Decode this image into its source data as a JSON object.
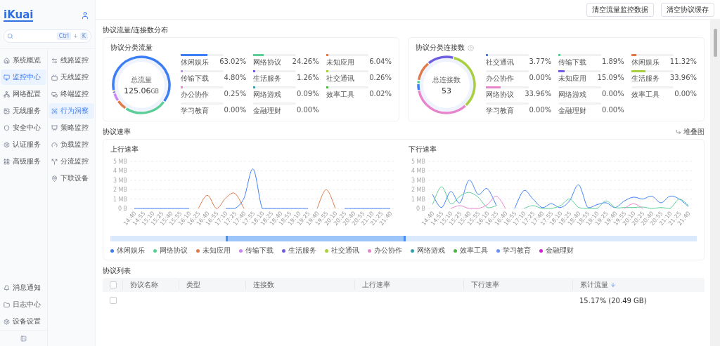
{
  "sidebar": {
    "logo": "iKuai",
    "search": {
      "keys": [
        "Ctrl",
        "K"
      ],
      "joiner": "+"
    },
    "nav": [
      {
        "label": "系统概览",
        "selected": false
      },
      {
        "label": "监控中心",
        "selected": true
      },
      {
        "label": "网络配置",
        "selected": false
      },
      {
        "label": "无线服务",
        "selected": false
      },
      {
        "label": "安全中心",
        "selected": false
      },
      {
        "label": "认证服务",
        "selected": false
      },
      {
        "label": "高级服务",
        "selected": false
      }
    ],
    "subnav": [
      {
        "label": "线路监控",
        "selected": false
      },
      {
        "label": "无线监控",
        "selected": false
      },
      {
        "label": "终端监控",
        "selected": false
      },
      {
        "label": "行为洞察",
        "selected": true
      },
      {
        "label": "策略监控",
        "selected": false
      },
      {
        "label": "负载监控",
        "selected": false
      },
      {
        "label": "分流监控",
        "selected": false
      },
      {
        "label": "下联设备",
        "selected": false
      }
    ],
    "footer_nav": [
      {
        "label": "消息通知"
      },
      {
        "label": "日志中心"
      },
      {
        "label": "设备设置"
      }
    ]
  },
  "toolbar": {
    "buttons": [
      "清空流量监控数据",
      "清空协议缓存"
    ]
  },
  "distribution": {
    "title": "协议流量/连接数分布",
    "cards": [
      {
        "title": "协议分类流量",
        "help": false,
        "center_label": "总流量",
        "center_value": "125.06",
        "center_unit": "GB",
        "items": [
          {
            "name": "休闲娱乐",
            "value": "63.02%",
            "level": 0.6302,
            "color": "#3d7ef5"
          },
          {
            "name": "网络协议",
            "value": "24.26%",
            "level": 0.2426,
            "color": "#5ccf98"
          },
          {
            "name": "未知应用",
            "value": "6.04%",
            "level": 0.0604,
            "color": "#e07a48"
          },
          {
            "name": "传输下载",
            "value": "4.80%",
            "level": 0.048,
            "color": "#c987f2"
          },
          {
            "name": "生活服务",
            "value": "1.26%",
            "level": 0.0126,
            "color": "#6f5fe0"
          },
          {
            "name": "社交通讯",
            "value": "0.26%",
            "level": 0.0026,
            "color": "#a8cf3f"
          },
          {
            "name": "办公协作",
            "value": "0.25%",
            "level": 0.0025,
            "color": "#e884cc"
          },
          {
            "name": "网络游戏",
            "value": "0.09%",
            "level": 0.0009,
            "color": "#3c9fa8"
          },
          {
            "name": "效率工具",
            "value": "0.02%",
            "level": 0.0002,
            "color": "#4cb845"
          },
          {
            "name": "学习教育",
            "value": "0.00%"
          },
          {
            "name": "金融理财",
            "value": "0.00%"
          }
        ]
      },
      {
        "title": "协议分类连接数",
        "help": true,
        "center_label": "总连接数",
        "center_value": "53",
        "items": [
          {
            "name": "社交通讯",
            "value": "3.77%",
            "level": 0.0377,
            "color": "#3d7ef5"
          },
          {
            "name": "传输下载",
            "value": "1.89%",
            "level": 0.0189,
            "color": "#5ccf98"
          },
          {
            "name": "休闲娱乐",
            "value": "11.32%",
            "level": 0.1132,
            "color": "#e07a48"
          },
          {
            "name": "办公协作",
            "value": "0.00%"
          },
          {
            "name": "未知应用",
            "value": "15.09%",
            "level": 0.1509,
            "color": "#6f5fe0"
          },
          {
            "name": "生活服务",
            "value": "33.96%",
            "level": 0.3396,
            "color": "#a8cf3f"
          },
          {
            "name": "网络协议",
            "value": "33.96%",
            "level": 0.3396,
            "color": "#e884cc"
          },
          {
            "name": "网络游戏",
            "value": "0.00%"
          },
          {
            "name": "效率工具",
            "value": "0.00%"
          },
          {
            "name": "学习教育",
            "value": "0.00%"
          },
          {
            "name": "金融理财",
            "value": "0.00%"
          }
        ]
      }
    ]
  },
  "rate": {
    "title": "协议速率",
    "stack_toggle": "堆叠图",
    "charts": [
      {
        "chart_data": {
          "type": "line",
          "title": "上行速率",
          "grid": true,
          "categories": [
            "14:40",
            "14:55",
            "15:10",
            "15:25",
            "15:40",
            "15:55",
            "16:10",
            "16:25",
            "16:40",
            "16:55",
            "17:10",
            "17:25",
            "17:40",
            "17:55",
            "18:10",
            "18:25",
            "18:40",
            "18:55",
            "19:10",
            "19:25",
            "19:40",
            "19:55",
            "20:10",
            "20:25",
            "20:40",
            "20:55",
            "21:10",
            "21:25",
            "21:40"
          ],
          "yticks": [
            {
              "value": 0,
              "label": "0 B"
            },
            {
              "value": 1,
              "label": "1 MB"
            },
            {
              "value": 2,
              "label": "2 MB"
            },
            {
              "value": 3,
              "label": "3 MB"
            },
            {
              "value": 4,
              "label": "4 MB"
            },
            {
              "value": 5,
              "label": "5 MB"
            }
          ],
          "ylim": [
            0,
            5
          ],
          "series": [
            {
              "color": "#3d7ef5",
              "values": [
                0,
                0,
                0,
                0,
                0,
                0,
                0,
                null,
                null,
                null,
                0,
                0,
                1.1,
                4.2,
                0,
                0,
                0,
                0,
                0,
                0,
                null,
                null,
                null,
                0,
                0,
                0,
                0,
                0,
                0
              ]
            },
            {
              "color": "#e07a48",
              "values": [
                null,
                null,
                null,
                null,
                null,
                null,
                null,
                0,
                1.4,
                0,
                1.1,
                1.6,
                0,
                null,
                null,
                null,
                null,
                null,
                null,
                null,
                0,
                2.0,
                0,
                null,
                null,
                null,
                null,
                null,
                null
              ]
            }
          ]
        }
      },
      {
        "chart_data": {
          "type": "line",
          "title": "下行速率",
          "grid": true,
          "categories": [
            "14:40",
            "14:55",
            "15:10",
            "15:25",
            "15:40",
            "15:55",
            "16:10",
            "16:25",
            "16:40",
            "16:55",
            "17:10",
            "17:25",
            "17:40",
            "17:55",
            "18:10",
            "18:25",
            "18:40",
            "18:55",
            "19:10",
            "19:25",
            "19:40",
            "19:55",
            "20:10",
            "20:25",
            "20:40",
            "20:55",
            "21:10",
            "21:25",
            "21:40"
          ],
          "yticks": [
            {
              "value": 0,
              "label": "0 B"
            },
            {
              "value": 1,
              "label": "1 MB"
            },
            {
              "value": 2,
              "label": "2 MB"
            },
            {
              "value": 3,
              "label": "3 MB"
            },
            {
              "value": 4,
              "label": "4 MB"
            },
            {
              "value": 5,
              "label": "5 MB"
            }
          ],
          "ylim": [
            0,
            5
          ],
          "series": [
            {
              "color": "#3d7ef5",
              "values": [
                1.5,
                0.1,
                1.8,
                0.6,
                3.0,
                1.5,
                2.1,
                0.3,
                null,
                0,
                1.9,
                1.0,
                0.1,
                0.5,
                0.1,
                0.8,
                2.5,
                0.1,
                0.4,
                0.6,
                0.1,
                0.8,
                1.2,
                1.0,
                1.3,
                0.6,
                1.3,
                1.0,
                0.2
              ]
            },
            {
              "color": "#5ccf98",
              "values": [
                0.4,
                2.3,
                0.5,
                1.3,
                1.7,
                1.2,
                0.1,
                0.3,
                null,
                null,
                0,
                0.3,
                0,
                0,
                0.3,
                1.0,
                0.1,
                0,
                0,
                0.8,
                0.1,
                0.1,
                0.1,
                0.15,
                0,
                0.1,
                0,
                1.0,
                0.3
              ]
            },
            {
              "color": "#e884cc",
              "values": [
                null,
                null,
                0,
                0.3,
                0,
                0,
                0.4,
                1.3,
                0,
                null,
                null,
                null,
                null,
                null,
                null,
                null,
                null,
                null,
                null,
                null,
                null,
                0,
                0.5,
                0,
                null,
                null,
                null,
                null,
                null
              ]
            }
          ]
        }
      }
    ],
    "zoom_slider": {
      "start": {
        "level": 0.198
      },
      "end": {
        "level": 0.501
      }
    },
    "legend": [
      {
        "name": "休闲娱乐",
        "color": "#3d7ef5"
      },
      {
        "name": "网络协议",
        "color": "#5ccf98"
      },
      {
        "name": "未知应用",
        "color": "#e07a48"
      },
      {
        "name": "传输下载",
        "color": "#c987f2"
      },
      {
        "name": "生活服务",
        "color": "#6f5fe0"
      },
      {
        "name": "社交通讯",
        "color": "#a8cf3f"
      },
      {
        "name": "办公协作",
        "color": "#e884cc"
      },
      {
        "name": "网络游戏",
        "color": "#3c9fa8"
      },
      {
        "name": "效率工具",
        "color": "#4cb845"
      },
      {
        "name": "学习教育",
        "color": "#6c90f0"
      },
      {
        "name": "金融理财",
        "color": "#d61fd6"
      }
    ]
  },
  "protocol_list": {
    "title": "协议列表",
    "header_checked": false,
    "columns": [
      {
        "label": "协议名称",
        "sorted": false
      },
      {
        "label": "类型",
        "sorted": false
      },
      {
        "label": "连接数",
        "sorted": false
      },
      {
        "label": "上行速率",
        "sorted": false
      },
      {
        "label": "下行速率",
        "sorted": false
      },
      {
        "label": "累计流量",
        "sorted": true
      }
    ],
    "rows": [
      {
        "checked": false,
        "traffic_share": "15.17%",
        "traffic_size": "(20.49 GB)"
      }
    ]
  }
}
